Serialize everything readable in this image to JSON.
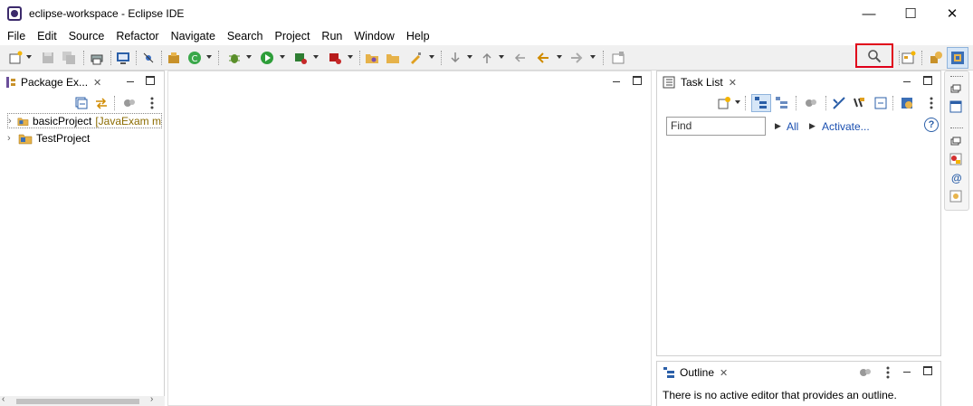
{
  "window": {
    "title": "eclipse-workspace - Eclipse IDE",
    "minimize": "—",
    "maximize": "☐",
    "close": "✕"
  },
  "menu": [
    "File",
    "Edit",
    "Source",
    "Refactor",
    "Navigate",
    "Search",
    "Project",
    "Run",
    "Window",
    "Help"
  ],
  "package_explorer": {
    "tab_label": "Package Ex...",
    "close": "✕",
    "items": [
      {
        "name": "basicProject",
        "decoration": "[JavaExam m"
      },
      {
        "name": "TestProject",
        "decoration": ""
      }
    ]
  },
  "task_list": {
    "tab_label": "Task List",
    "close": "✕",
    "find_placeholder": "Find",
    "all_link": "All",
    "activate_link": "Activate...",
    "help": "?"
  },
  "outline": {
    "tab_label": "Outline",
    "close": "✕",
    "message": "There is no active editor that provides an outline."
  },
  "colors": {
    "highlight_box": "#e0001a",
    "link": "#1a4fb0",
    "toolbar_bg": "#f0f0f0"
  },
  "icons": {
    "search_toolbar": "search-icon"
  }
}
